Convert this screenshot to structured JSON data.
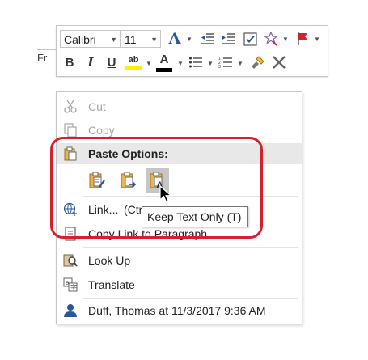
{
  "background_doc": {
    "fragment": "Fr"
  },
  "toolbar": {
    "font_name": "Calibri",
    "font_size": "11",
    "bold": "B",
    "italic": "I",
    "underline": "U",
    "font_color_letter": "A",
    "styles_letter": "A",
    "highlight_letters": "ab",
    "highlight_color": "#ffee00",
    "font_color": "#000000",
    "flag_color": "#d6212c",
    "check_color": "#2b579a"
  },
  "menu": {
    "cut": "Cut",
    "copy": "Copy",
    "paste_options_header": "Paste Options:",
    "paste_options": [
      "keep-source-formatting-icon",
      "merge-formatting-icon",
      "keep-text-only-icon"
    ],
    "link": "Link...",
    "link_suffix": "(Ctr",
    "copy_link": "Copy Link to Paragraph",
    "look_up": "Look Up",
    "translate": "Translate",
    "comment": "Duff, Thomas at 11/3/2017 9:36 AM"
  },
  "tooltip": {
    "text": "Keep Text Only (T)"
  },
  "highlight_color": "#d6212c"
}
